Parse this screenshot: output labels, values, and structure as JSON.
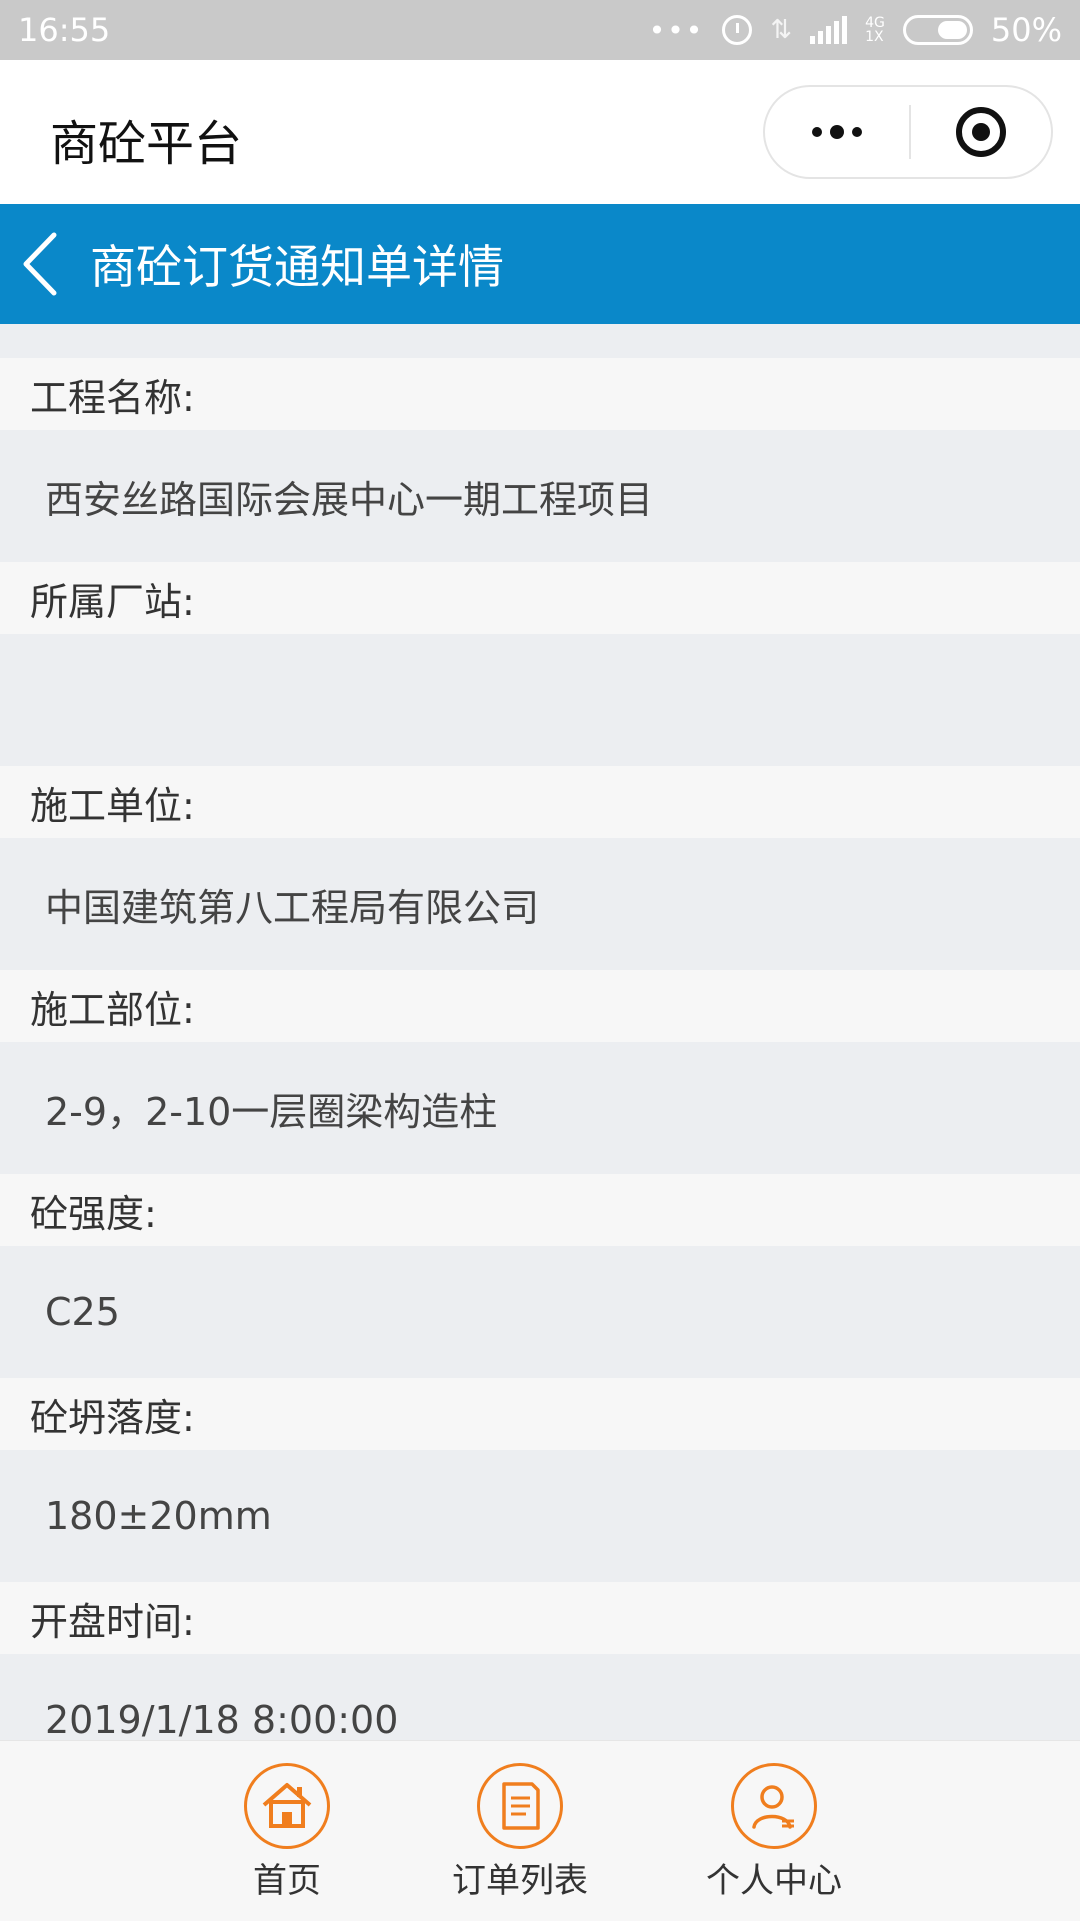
{
  "status_bar": {
    "time": "16:55",
    "network": "4G",
    "network_sub": "1X",
    "battery": "50%"
  },
  "app": {
    "title": "商砼平台"
  },
  "page": {
    "title": "商砼订货通知单详情"
  },
  "fields": [
    {
      "label": "工程名称:",
      "value": "西安丝路国际会展中心一期工程项目"
    },
    {
      "label": "所属厂站:",
      "value": ""
    },
    {
      "label": "施工单位:",
      "value": "中国建筑第八工程局有限公司"
    },
    {
      "label": "施工部位:",
      "value": "2-9，2-10一层圈梁构造柱"
    },
    {
      "label": "砼强度:",
      "value": "C25"
    },
    {
      "label": "砼坍落度:",
      "value": "180±20mm"
    },
    {
      "label": "开盘时间:",
      "value": "2019/1/18 8:00:00"
    }
  ],
  "tabbar": {
    "items": [
      {
        "label": "首页",
        "icon": "home-icon"
      },
      {
        "label": "订单列表",
        "icon": "order-list-icon"
      },
      {
        "label": "个人中心",
        "icon": "user-icon"
      }
    ],
    "accent": "#f07e1e"
  },
  "colors": {
    "header_blue": "#0a88c9",
    "status_bar": "#c9c9c9"
  }
}
